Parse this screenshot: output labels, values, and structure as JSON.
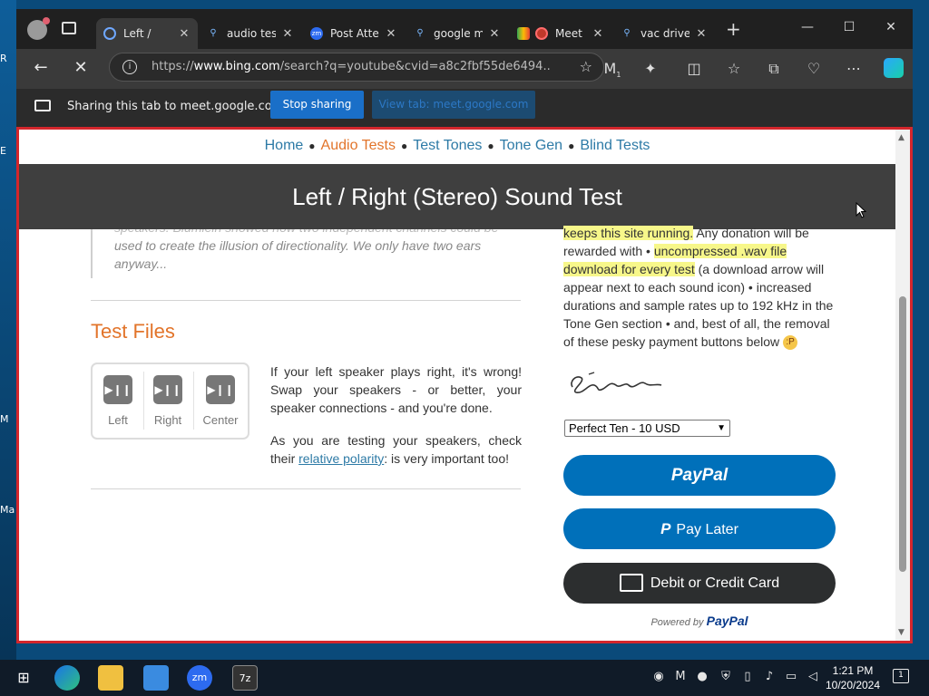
{
  "desktop": {
    "edge_letters": [
      "R",
      "E",
      "M",
      "Ma"
    ]
  },
  "browser": {
    "tabs": [
      {
        "label": "Left /",
        "icon": "loading-icon",
        "active": true
      },
      {
        "label": "audio test",
        "icon": "search-icon"
      },
      {
        "label": "Post Atter",
        "icon": "zoom-icon",
        "icon_text": "zm"
      },
      {
        "label": "google m",
        "icon": "search-icon"
      },
      {
        "label": "Meet",
        "icon": "meet-icon"
      },
      {
        "label": "vac driver",
        "icon": "search-icon"
      }
    ],
    "url_prefix": "https://",
    "url_host": "www.bing.com",
    "url_rest": "/search?q=youtube&cvid=a8c2fbf55de6494...",
    "extension_badge": "1",
    "share_bar": {
      "text": "Sharing this tab to meet.google.com",
      "stop_label": "Stop sharing",
      "view_label": "View tab: meet.google.com"
    }
  },
  "page": {
    "nav": [
      "Home",
      "Audio Tests",
      "Test Tones",
      "Tone Gen",
      "Blind Tests"
    ],
    "nav_current": "Audio Tests",
    "title": "Left / Right (Stereo) Sound Test",
    "quote_lines": [
      "speakers. Blumlein showed how two independent channels could be",
      "used to create the illusion of directionality. We only have two ears",
      "anyway..."
    ],
    "test_files_heading": "Test Files",
    "player": [
      {
        "label": "Left",
        "icon": "play-pause-icon"
      },
      {
        "label": "Right",
        "icon": "play-pause-icon"
      },
      {
        "label": "Center",
        "icon": "play-pause-icon"
      }
    ],
    "play_glyph": "▶❙❙",
    "desc_p1": "If your left speaker plays right, it's wrong! Swap your speakers - or better, your speaker connections - and you're done.",
    "desc_p2_before": "As you are testing your speakers, check their ",
    "desc_p2_link": "relative polarity",
    "desc_p2_after": ": is very important too!",
    "donate": {
      "hl1": "keeps this site running.",
      "t1": " Any donation will be rewarded with • ",
      "hl2": "uncompressed .wav file download for every test",
      "t2": " (a download arrow will appear next to each sound icon) • increased durations and sample rates up to 192 kHz in the Tone Gen section • and, best of all, the removal of these pesky payment buttons below ",
      "emoji": "😛",
      "signature": "Stéphane"
    },
    "amount_selected": "Perfect Ten - 10 USD",
    "paypal_label": "PayPal",
    "paylater_label": "Pay Later",
    "card_label": "Debit or Credit Card",
    "powered_by": "Powered by",
    "powered_brand": "PayPal"
  },
  "taskbar": {
    "time": "1:21 PM",
    "date": "10/20/2024",
    "notification_count": "1"
  },
  "colors": {
    "accent": "#e2742a",
    "link": "#2d7aa6",
    "paypal_blue": "#0070ba",
    "frame_red": "#d4262c"
  }
}
